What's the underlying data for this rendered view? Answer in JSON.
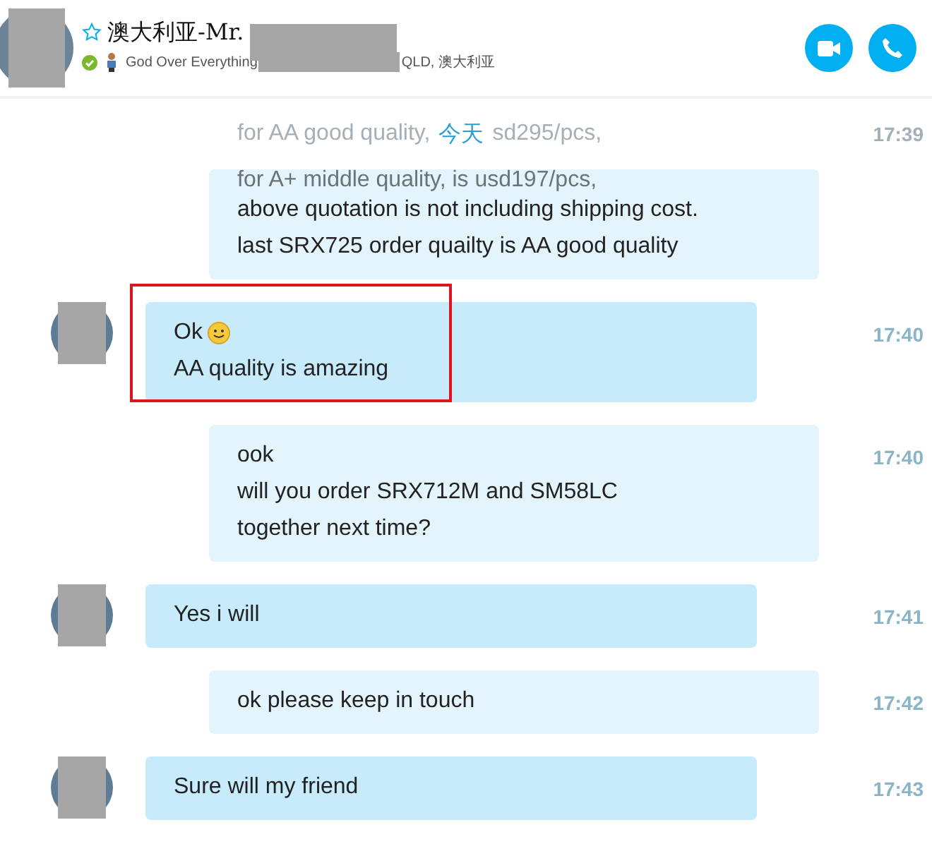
{
  "contact": {
    "name": "澳大利亚-Mr.",
    "mood": "God Over Everything",
    "location": "QLD, 澳大利亚",
    "online": true,
    "favorite": false
  },
  "faded": {
    "left": "for AA good quality,",
    "date": "今天",
    "right": "sd295/pcs,",
    "time": "17:39"
  },
  "messages": [
    {
      "kind": "sent",
      "lines": [
        {
          "text": "for A+ middle quality, is usd197/pcs,",
          "faded": true
        },
        {
          "text": "above quotation is not including shipping cost."
        },
        {
          "text": "last SRX725 order  quailty is AA good quality"
        }
      ],
      "highlighted": false
    },
    {
      "kind": "received",
      "lines": [
        {
          "text": "Ok",
          "emoji": true
        },
        {
          "text": "AA quality is amazing"
        }
      ],
      "time": "17:40",
      "highlighted": true
    },
    {
      "kind": "sent",
      "lines": [
        {
          "text": "ook"
        },
        {
          "text": "will you order SRX712M and SM58LC"
        },
        {
          "text": "together next time?"
        }
      ],
      "time": "17:40",
      "highlighted": false
    },
    {
      "kind": "received",
      "lines": [
        {
          "text": "Yes i will"
        }
      ],
      "time": "17:41",
      "highlighted": false
    },
    {
      "kind": "sent",
      "lines": [
        {
          "text": "ok please keep in touch"
        }
      ],
      "time": "17:42",
      "highlighted": false
    },
    {
      "kind": "received",
      "lines": [
        {
          "text": "Sure will my friend"
        }
      ],
      "time": "17:43",
      "highlighted": false
    }
  ]
}
